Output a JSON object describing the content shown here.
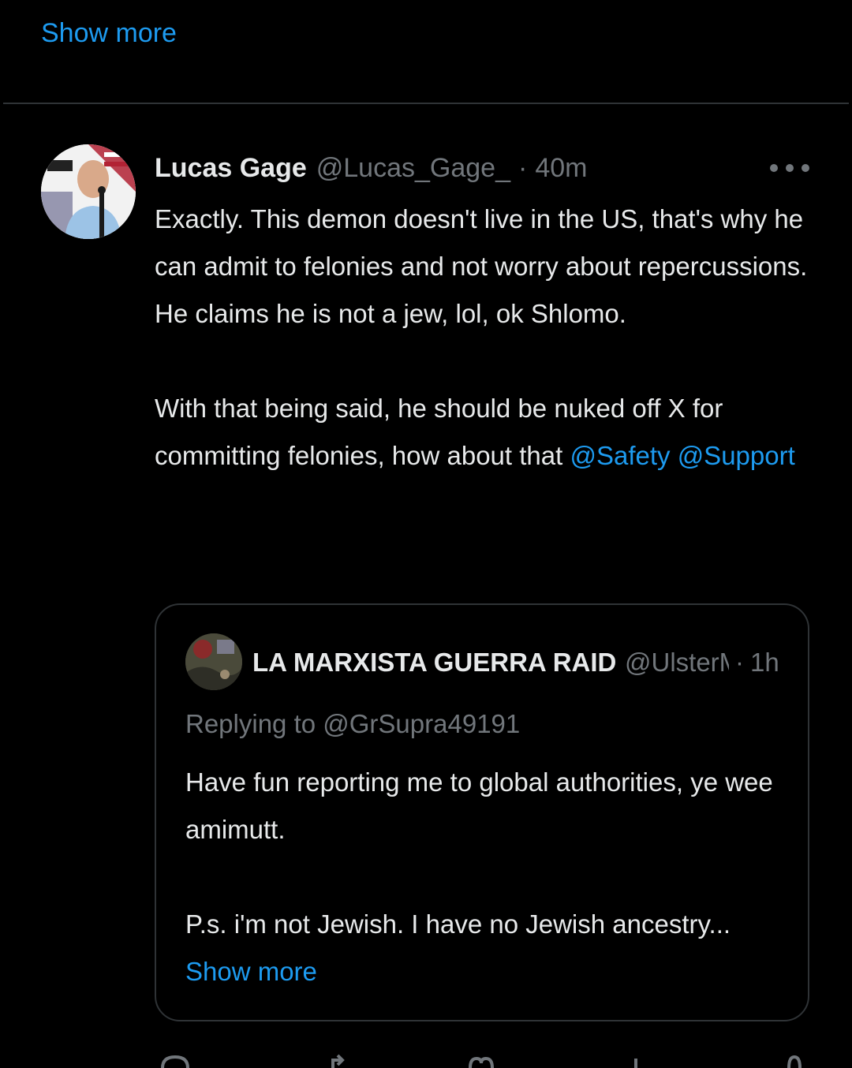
{
  "top": {
    "show_more": "Show more"
  },
  "tweet": {
    "author_name": "Lucas Gage",
    "author_handle": "@Lucas_Gage_",
    "separator": "·",
    "time": "40m",
    "body": {
      "line1": "Exactly.  This demon doesn't live in the US, that's why he can admit to felonies and not worry about repercussions.  He claims he is not a jew, lol, ok Shlomo.",
      "line2_text": "With that being said, he should be nuked off X for committing felonies, how about that ",
      "mention1": "@Safety",
      "mention2": "@Support"
    },
    "more_icon": "more-horizontal-icon"
  },
  "quote": {
    "author_name": "LA MARXISTA GUERRA RAIDER",
    "author_handle": "@UlsterMarxist",
    "separator": "·",
    "time": "1h",
    "replying_prefix": "Replying to ",
    "replying_handle": "@GrSupra49191",
    "body_p1": "Have fun reporting me to global authorities, ye wee amimutt.",
    "body_p2": "P.s. i'm not Jewish. I have no Jewish ancestry...",
    "show_more": "Show more"
  },
  "colors": {
    "background": "#000000",
    "text": "#e7e9ea",
    "muted": "#71767b",
    "accent": "#1d9bf0",
    "border": "#2f3336"
  },
  "icons": [
    "reply-icon",
    "repost-icon",
    "like-icon",
    "views-icon",
    "bookmark-icon"
  ]
}
